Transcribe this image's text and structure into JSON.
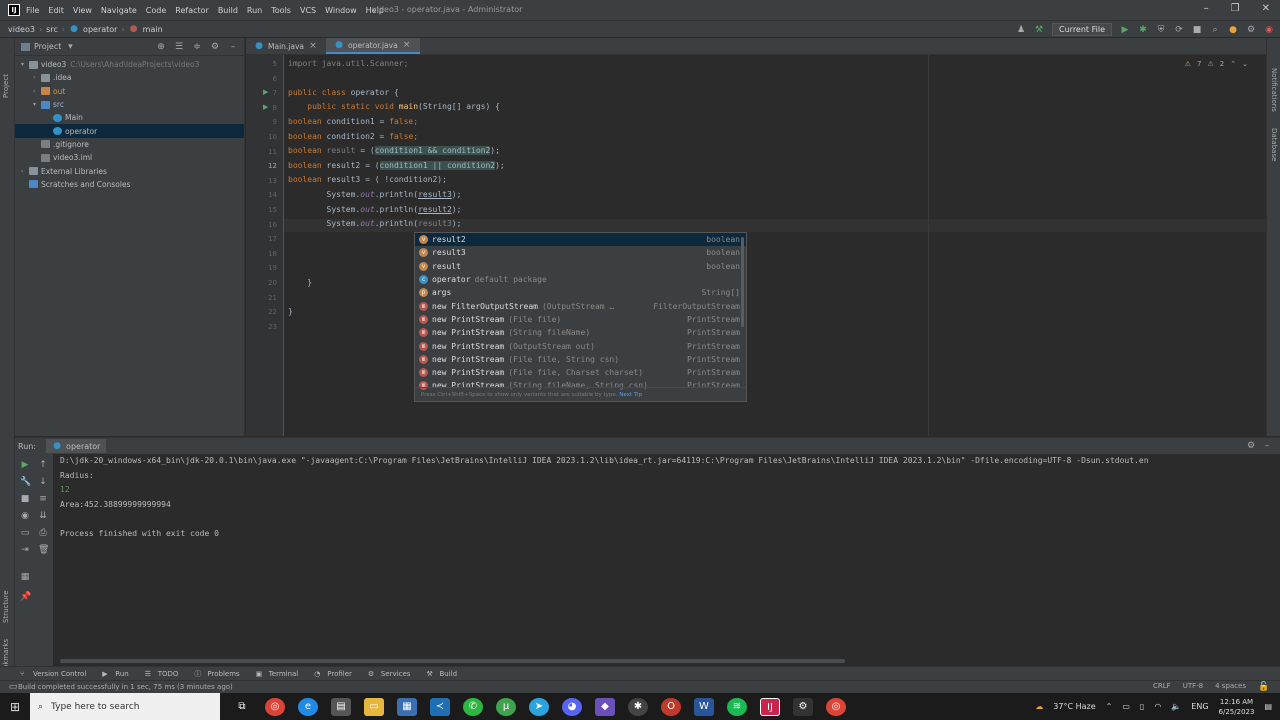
{
  "titlebar": {
    "menu": [
      "File",
      "Edit",
      "View",
      "Navigate",
      "Code",
      "Refactor",
      "Build",
      "Run",
      "Tools",
      "VCS",
      "Window",
      "Help"
    ],
    "window_title": "video3 - operator.java - Administrator"
  },
  "navbar": {
    "crumbs": [
      "video3",
      "src",
      "operator",
      "main"
    ],
    "run_config": "Current File"
  },
  "project": {
    "title": "Project",
    "tree": [
      {
        "label": "video3",
        "path": "C:\\Users\\Ahad\\IdeaProjects\\video3",
        "indent": 0,
        "icon": "folder"
      },
      {
        "label": ".idea",
        "indent": 1,
        "icon": "folder"
      },
      {
        "label": "out",
        "indent": 1,
        "icon": "folder-orange"
      },
      {
        "label": "src",
        "indent": 1,
        "icon": "folder-blue"
      },
      {
        "label": "Main",
        "indent": 2,
        "icon": "class"
      },
      {
        "label": "operator",
        "indent": 2,
        "icon": "class"
      },
      {
        "label": ".gitignore",
        "indent": 1,
        "icon": "file"
      },
      {
        "label": "video3.iml",
        "indent": 1,
        "icon": "file"
      },
      {
        "label": "External Libraries",
        "indent": 0,
        "icon": "library"
      },
      {
        "label": "Scratches and Consoles",
        "indent": 0,
        "icon": "scratch"
      }
    ]
  },
  "editor": {
    "tabs": [
      "Main.java",
      "operator.java"
    ],
    "active_tab": "operator.java",
    "inspections": [
      "7",
      "2"
    ],
    "line_numbers": [
      "5",
      "6",
      "7",
      "8",
      "9",
      "10",
      "11",
      "12",
      "13",
      "14",
      "15",
      "16",
      "17",
      "18",
      "19",
      "20",
      "21",
      "22",
      "23"
    ],
    "code": {
      "l5": "import java.util.Scanner;",
      "l7a": "public class ",
      "l7b": "operator {",
      "l8a": "    public static void ",
      "l8b": "main",
      "l8c": "(String[] args) {",
      "l9a": "boolean ",
      "l9b": "condition1 = ",
      "l9c": "false;",
      "l10a": "boolean ",
      "l10b": "condition2 = ",
      "l10c": "false;",
      "l11a": "boolean ",
      "l11b": "result",
      "l11c": " = (",
      "l11d": "condition1 && condition2",
      "l11e": ");",
      "l12a": "boolean ",
      "l12b": "result2 = (",
      "l12c": "condition1 || condition2",
      "l12d": ");",
      "l13a": "boolean ",
      "l13b": "result3 = ( !condition2);",
      "l14a": "        System.",
      "l14b": "out",
      "l14c": ".println(",
      "l14d": "result3",
      "l14e": ");",
      "l15a": "        System.",
      "l15b": "out",
      "l15c": ".println(",
      "l15d": "result2",
      "l15e": ");",
      "l16a": "        System.",
      "l16b": "out",
      "l16c": ".println(",
      "l16d": "result3",
      "l16e": ");",
      "l18": "    }",
      "l20": "}"
    }
  },
  "popup": {
    "items": [
      {
        "kind": "v",
        "name": "result2",
        "tail": "",
        "type": "boolean"
      },
      {
        "kind": "v",
        "name": "result3",
        "tail": "",
        "type": "boolean"
      },
      {
        "kind": "v",
        "name": "result",
        "tail": "",
        "type": "boolean"
      },
      {
        "kind": "c",
        "name": "operator",
        "tail": "default package",
        "type": ""
      },
      {
        "kind": "p",
        "name": "args",
        "tail": "",
        "type": "String[]"
      },
      {
        "kind": "m",
        "name": "new FilterOutputStream",
        "tail": "(OutputStream …",
        "type": "FilterOutputStream"
      },
      {
        "kind": "m",
        "name": "new PrintStream",
        "tail": "(File file)",
        "type": "PrintStream"
      },
      {
        "kind": "m",
        "name": "new PrintStream",
        "tail": "(String fileName)",
        "type": "PrintStream"
      },
      {
        "kind": "m",
        "name": "new PrintStream",
        "tail": "(OutputStream out)",
        "type": "PrintStream"
      },
      {
        "kind": "m",
        "name": "new PrintStream",
        "tail": "(File file, String csn)",
        "type": "PrintStream"
      },
      {
        "kind": "m",
        "name": "new PrintStream",
        "tail": "(File file, Charset charset)",
        "type": "PrintStream"
      },
      {
        "kind": "m",
        "name": "new PrintStream",
        "tail": "(String fileName, String csn)",
        "type": "PrintStream"
      }
    ],
    "footer": "Press Ctrl+Shift+Space to show only variants that are suitable by type.",
    "footer_link": "Next Tip"
  },
  "right_strip": [
    "Notifications",
    "Database"
  ],
  "left_strip": [
    "Project",
    "Structure",
    "Bookmarks"
  ],
  "run": {
    "label": "Run:",
    "tab": "operator",
    "lines": [
      {
        "text": "D:\\jdk-20_windows-x64_bin\\jdk-20.0.1\\bin\\java.exe \"-javaagent:C:\\Program Files\\JetBrains\\IntelliJ IDEA 2023.1.2\\lib\\idea_rt.jar=64119:C:\\Program Files\\JetBrains\\IntelliJ IDEA 2023.1.2\\bin\" -Dfile.encoding=UTF-8 -Dsun.stdout.en",
        "input": false
      },
      {
        "text": "Radius:",
        "input": false
      },
      {
        "text": "12",
        "input": true
      },
      {
        "text": "Area:452.38899999999994",
        "input": false
      },
      {
        "text": "",
        "input": false
      },
      {
        "text": "Process finished with exit code 0",
        "input": false
      }
    ]
  },
  "tooltabs": [
    "Version Control",
    "Run",
    "TODO",
    "Problems",
    "Terminal",
    "Profiler",
    "Services",
    "Build"
  ],
  "status": {
    "message": "Build completed successfully in 1 sec, 75 ms (3 minutes ago)",
    "right": [
      "CRLF",
      "UTF-8",
      "4 spaces"
    ]
  },
  "taskbar": {
    "search_placeholder": "Type here to search",
    "weather": "37°C  Haze",
    "lang": "ENG",
    "time": "12:16 AM",
    "date": "6/25/2023"
  }
}
